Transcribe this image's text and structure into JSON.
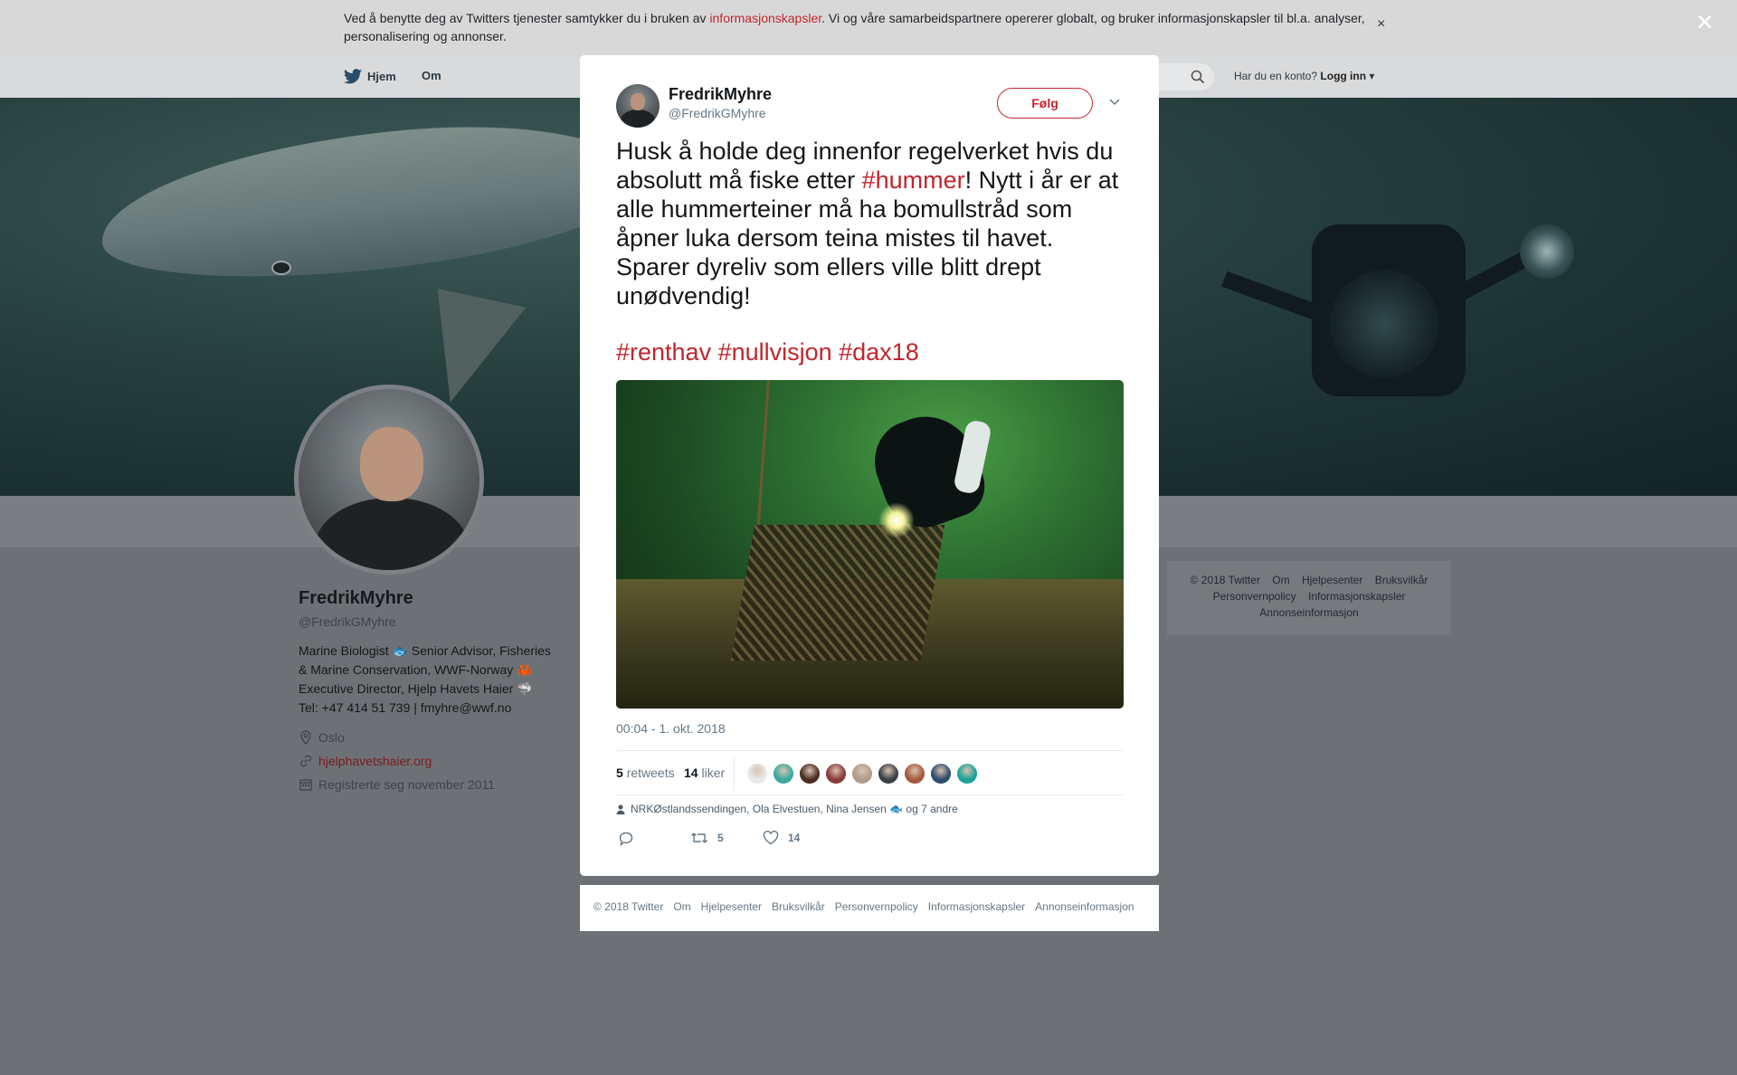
{
  "cookie_banner": {
    "text_before": "Ved å benytte deg av Twitters tjenester samtykker du i bruken av ",
    "link": "informasjonskapsler",
    "text_after": ". Vi og våre samarbeidspartnere opererer globalt, og bruker informasjonskapsler til bl.a. analyser, personalisering og annonser.",
    "close_glyph": "×"
  },
  "global_nav": {
    "home": "Hjem",
    "about": "Om",
    "account_prompt": "Har du en konto?",
    "login": "Logg inn"
  },
  "profile": {
    "name": "FredrikMyhre",
    "handle": "@FredrikGMyhre",
    "bio_1": "Marine Biologist 🐟 Senior Advisor, Fisheries & Marine Conservation, WWF-Norway 🦀",
    "bio_2": "Executive Director, Hjelp Havets Haier 🦈",
    "bio_3": "Tel: +47 414 51 739 | fmyhre@wwf.no",
    "location": "Oslo",
    "website": "hjelphavetshaier.org",
    "joined": "Registrerte seg november 2011"
  },
  "bg_footer": {
    "row1": [
      "© 2018 Twitter",
      "Om",
      "Hjelpesenter",
      "Bruksvilkår"
    ],
    "row2": [
      "Personvernpolicy",
      "Informasjonskapsler"
    ],
    "row3": [
      "Annonseinformasjon"
    ]
  },
  "tweet": {
    "name": "FredrikMyhre",
    "handle": "@FredrikGMyhre",
    "follow_label": "Følg",
    "text_before": "Husk å holde deg innenfor regelverket hvis du absolutt må fiske etter ",
    "text_tag": "#hummer",
    "text_after": "! Nytt i år er at alle hummerteiner må ha bomullstråd som åpner luka dersom teina mistes til havet. Sparer dyreliv som ellers ville blitt drept unødvendig!",
    "hashtags": "#renthav #nullvisjon #dax18",
    "timestamp": "00:04 - 1. okt. 2018",
    "retweets_count": "5",
    "retweets_label": "retweets",
    "likes_count": "14",
    "likes_label": "liker",
    "liker_colors": [
      "#e9e9e9",
      "#3aa9a0",
      "#4a2d22",
      "#8a3a3a",
      "#b39b8a",
      "#3a3f44",
      "#a4583e",
      "#2d4b6b",
      "#1aa39a"
    ],
    "reply_context": "NRKØstlandssendingen, Ola Elvestuen, Nina Jensen 🐟 og 7 andre",
    "action_retweets": "5",
    "action_likes": "14",
    "accent_color": "#c0262d"
  },
  "modal_footer": {
    "links": [
      "© 2018 Twitter",
      "Om",
      "Hjelpesenter",
      "Bruksvilkår",
      "Personvernpolicy",
      "Informasjonskapsler",
      "Annonseinformasjon"
    ]
  },
  "close_overlay": "×"
}
